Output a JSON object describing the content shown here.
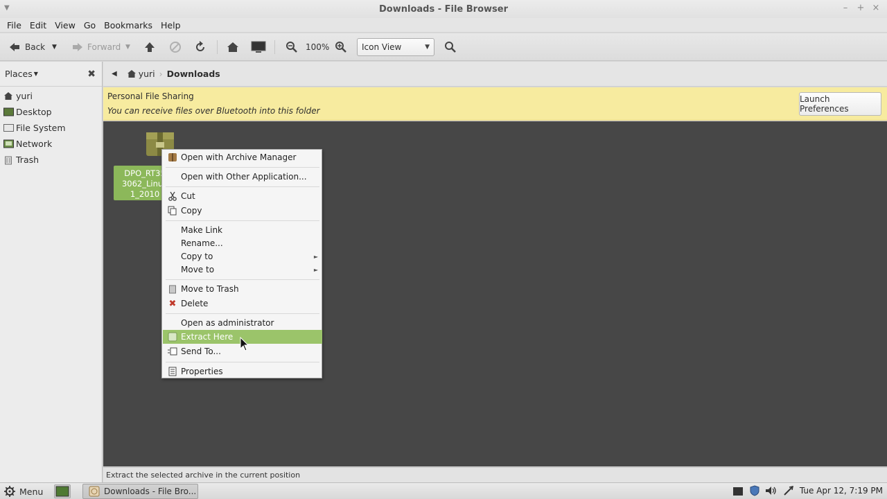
{
  "window": {
    "title": "Downloads - File Browser"
  },
  "menubar": [
    "File",
    "Edit",
    "View",
    "Go",
    "Bookmarks",
    "Help"
  ],
  "toolbar": {
    "back_label": "Back",
    "forward_label": "Forward",
    "zoom_level": "100%",
    "view_mode": "Icon View"
  },
  "sidebar": {
    "header": "Places",
    "items": [
      {
        "label": "yuri",
        "icon": "home-icon"
      },
      {
        "label": "Desktop",
        "icon": "desktop-icon"
      },
      {
        "label": "File System",
        "icon": "drive-icon"
      },
      {
        "label": "Network",
        "icon": "network-icon"
      },
      {
        "label": "Trash",
        "icon": "trash-icon"
      }
    ]
  },
  "location": {
    "home": "yuri",
    "current": "Downloads"
  },
  "infobar": {
    "title": "Personal File Sharing",
    "message": "You can receive files over Bluetooth into this folder",
    "button": "Launch Preferences"
  },
  "file": {
    "label_line1": "DPO_RT35",
    "label_line2": "3062_Linux",
    "label_line3": "1_2010",
    "icon": "archive-icon"
  },
  "context_menu": [
    {
      "label": "Open with Archive Manager",
      "icon": "archive-manager-icon"
    },
    {
      "label": "Open with Other Application..."
    },
    {
      "label": "Cut",
      "icon": "scissors-icon"
    },
    {
      "label": "Copy",
      "icon": "copy-icon"
    },
    {
      "label": "Make Link"
    },
    {
      "label": "Rename..."
    },
    {
      "label": "Copy to",
      "submenu": true
    },
    {
      "label": "Move to",
      "submenu": true
    },
    {
      "label": "Move to Trash",
      "icon": "trash-icon"
    },
    {
      "label": "Delete",
      "icon": "delete-icon"
    },
    {
      "label": "Open as administrator"
    },
    {
      "label": "Extract Here",
      "icon": "extract-icon",
      "highlighted": true
    },
    {
      "label": "Send To...",
      "icon": "send-icon"
    },
    {
      "label": "Properties",
      "icon": "properties-icon"
    }
  ],
  "statusbar": {
    "text": "Extract the selected archive in the current position"
  },
  "taskbar": {
    "menu_label": "Menu",
    "window_label": "Downloads - File Bro...",
    "clock": "Tue Apr 12,  7:19 PM"
  },
  "colors": {
    "selection": "#9bc46a",
    "infobar": "#f7eb9f",
    "content_bg": "#474747"
  }
}
